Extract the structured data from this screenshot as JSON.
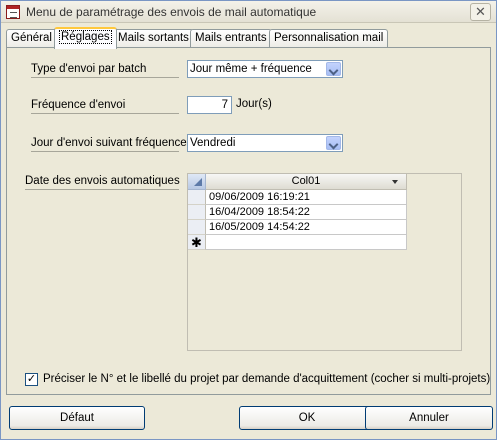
{
  "window": {
    "title": "Menu de paramétrage des envois de mail automatique",
    "close_glyph": "✕"
  },
  "tabs": [
    {
      "label": "Général"
    },
    {
      "label": "Réglages",
      "active": true
    },
    {
      "label": "Mails sortants"
    },
    {
      "label": "Mails entrants"
    },
    {
      "label": "Personnalisation mail"
    }
  ],
  "form": {
    "batch_type": {
      "label": "Type d'envoi par batch",
      "value": "Jour même + fréquence"
    },
    "frequency": {
      "label": "Fréquence d'envoi",
      "value": "7",
      "unit": "Jour(s)"
    },
    "day": {
      "label": "Jour d'envoi suivant fréquence",
      "value": "Vendredi"
    },
    "dates": {
      "label": "Date des envois automatiques",
      "column_header": "Col01",
      "rows": [
        "09/06/2009 16:19:21",
        "16/04/2009 18:54:22",
        "16/05/2009 14:54:22"
      ],
      "new_row_marker": "✱"
    },
    "ack_checkbox": {
      "label": "Préciser le N° et le libellé du projet par demande d'acquittement (cocher si multi-projets)",
      "checked": true,
      "mark": "✓"
    }
  },
  "buttons": {
    "default": "Défaut",
    "ok": "OK",
    "cancel": "Annuler"
  }
}
